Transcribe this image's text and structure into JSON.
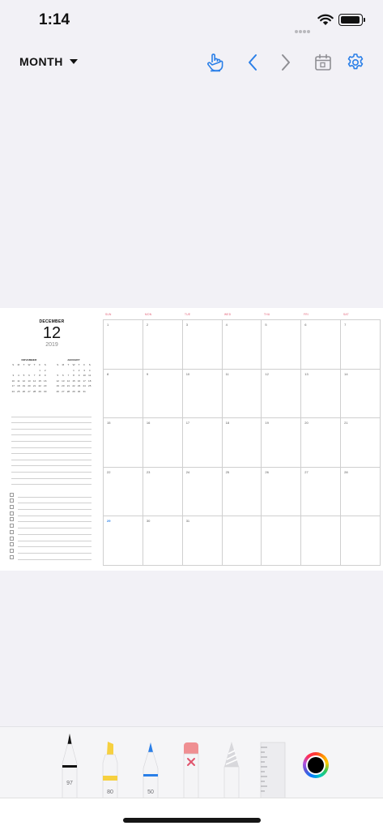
{
  "status": {
    "time": "1:14"
  },
  "toolbar": {
    "view_label": "MONTH",
    "accent_color": "#2a7fe8",
    "icons": [
      "hand-pointer-icon",
      "chevron-left-icon",
      "chevron-right-icon",
      "calendar-today-icon",
      "gear-icon"
    ]
  },
  "planner": {
    "month_name": "DECEMBER",
    "day": "12",
    "year": "2019",
    "mini_prev": {
      "title": "NOVEMBER",
      "days": [
        "S",
        "M",
        "T",
        "W",
        "T",
        "F",
        "S",
        "",
        "",
        "",
        "",
        "",
        "1",
        "2",
        "3",
        "4",
        "5",
        "6",
        "7",
        "8",
        "9",
        "10",
        "11",
        "12",
        "13",
        "14",
        "15",
        "16",
        "17",
        "18",
        "19",
        "20",
        "21",
        "22",
        "23",
        "24",
        "25",
        "26",
        "27",
        "28",
        "29",
        "30"
      ]
    },
    "mini_next": {
      "title": "JANUARY",
      "days": [
        "S",
        "M",
        "T",
        "W",
        "T",
        "F",
        "S",
        "",
        "",
        "",
        "1",
        "2",
        "3",
        "4",
        "5",
        "6",
        "7",
        "8",
        "9",
        "10",
        "11",
        "12",
        "13",
        "14",
        "15",
        "16",
        "17",
        "18",
        "19",
        "20",
        "21",
        "22",
        "23",
        "24",
        "25",
        "26",
        "27",
        "28",
        "29",
        "30",
        "31"
      ]
    },
    "weekdays": [
      "SUN",
      "MON",
      "TUE",
      "WED",
      "THU",
      "FRI",
      "SAT"
    ],
    "dates": [
      "1",
      "2",
      "3",
      "4",
      "5",
      "6",
      "7",
      "8",
      "9",
      "10",
      "11",
      "12",
      "13",
      "14",
      "15",
      "16",
      "17",
      "18",
      "19",
      "20",
      "21",
      "22",
      "23",
      "24",
      "25",
      "26",
      "27",
      "28",
      "29",
      "30",
      "31",
      "",
      "",
      "",
      ""
    ],
    "highlight_date": "29",
    "highlight_color": "#2a7fe8",
    "weekday_color": "#e0556d"
  },
  "tools": [
    {
      "name": "pen",
      "label": "97",
      "color": "#111111"
    },
    {
      "name": "marker",
      "label": "80",
      "color": "#f6d040"
    },
    {
      "name": "pen-blue",
      "label": "50",
      "color": "#2a7fe8"
    },
    {
      "name": "eraser",
      "label": "",
      "color": "#ef8f92"
    },
    {
      "name": "pencil",
      "label": "",
      "color": "#9a9a9a"
    },
    {
      "name": "ruler",
      "label": "",
      "color": "#e9e9ec"
    }
  ],
  "selected_color": "#000000"
}
